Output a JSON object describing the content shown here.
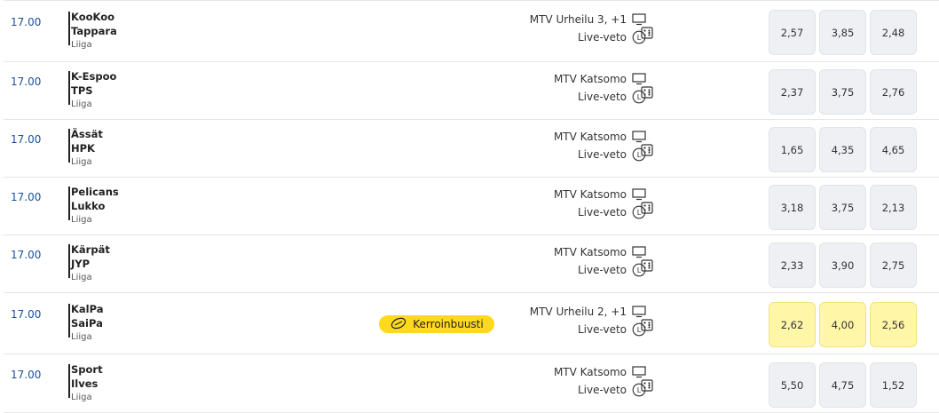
{
  "matches": [
    {
      "time": "17.00",
      "home": "KooKoo",
      "away": "Tappara",
      "league": "Liiga",
      "channel": "MTV Urheilu 3, +1",
      "live": "Live-veto",
      "odds": [
        "2,57",
        "3,85",
        "2,48"
      ],
      "boost": false
    },
    {
      "time": "17.00",
      "home": "K-Espoo",
      "away": "TPS",
      "league": "Liiga",
      "channel": "MTV Katsomo",
      "live": "Live-veto",
      "odds": [
        "2,37",
        "3,75",
        "2,76"
      ],
      "boost": false
    },
    {
      "time": "17.00",
      "home": "Ässät",
      "away": "HPK",
      "league": "Liiga",
      "channel": "MTV Katsomo",
      "live": "Live-veto",
      "odds": [
        "1,65",
        "4,35",
        "4,65"
      ],
      "boost": false
    },
    {
      "time": "17.00",
      "home": "Pelicans",
      "away": "Lukko",
      "league": "Liiga",
      "channel": "MTV Katsomo",
      "live": "Live-veto",
      "odds": [
        "3,18",
        "3,75",
        "2,13"
      ],
      "boost": false
    },
    {
      "time": "17.00",
      "home": "Kärpät",
      "away": "JYP",
      "league": "Liiga",
      "channel": "MTV Katsomo",
      "live": "Live-veto",
      "odds": [
        "2,33",
        "3,90",
        "2,75"
      ],
      "boost": false
    },
    {
      "time": "17.00",
      "home": "KalPa",
      "away": "SaiPa",
      "league": "Liiga",
      "channel": "MTV Urheilu 2, +1",
      "live": "Live-veto",
      "odds": [
        "2,62",
        "4,00",
        "2,56"
      ],
      "boost": true,
      "boost_label": "Kerroinbuusti"
    },
    {
      "time": "17.00",
      "home": "Sport",
      "away": "Ilves",
      "league": "Liiga",
      "channel": "MTV Katsomo",
      "live": "Live-veto",
      "odds": [
        "5,50",
        "4,75",
        "1,52"
      ],
      "boost": false
    }
  ],
  "colors": {
    "time": "#1b4f9c",
    "boost_pill": "#ffd91f",
    "boost_odd": "#fff6a8",
    "odd": "#eef0f3"
  },
  "icons": {
    "channel": "tv-icon",
    "live": "live-icon",
    "stats": "dice-icon",
    "boost": "boost-icon"
  }
}
